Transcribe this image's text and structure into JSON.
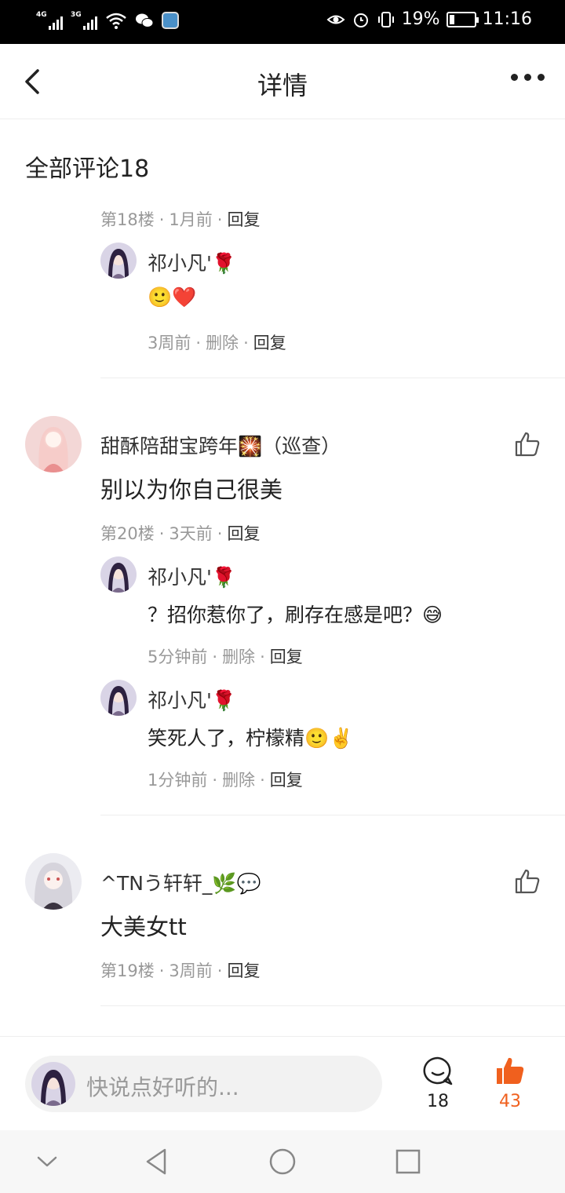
{
  "status_bar": {
    "signal_1": "4G",
    "signal_2": "3G",
    "battery": "19%",
    "time": "11:16"
  },
  "header": {
    "title": "详情"
  },
  "comments_title": "全部评论18",
  "first_block": {
    "meta": {
      "floor": "第18楼",
      "time": "1月前",
      "reply": "回复"
    },
    "replies": [
      {
        "name": "祁小凡'🌹",
        "text": "🙂❤️",
        "time": "3周前",
        "delete": "删除",
        "reply": "回复"
      }
    ]
  },
  "comments": [
    {
      "name": "甜酥陪甜宝跨年🎇（巡查）",
      "text": "别以为你自己很美",
      "meta": {
        "floor": "第20楼",
        "time": "3天前",
        "reply": "回复"
      },
      "replies": [
        {
          "name": "祁小凡'🌹",
          "text": "？招你惹你了，刷存在感是吧？😅",
          "time": "5分钟前",
          "delete": "删除",
          "reply": "回复"
        },
        {
          "name": "祁小凡'🌹",
          "text": "笑死人了，柠檬精🙂✌️",
          "time": "1分钟前",
          "delete": "删除",
          "reply": "回复"
        }
      ]
    },
    {
      "name": "^TNう轩轩_🌿💬",
      "text": "大美女tt",
      "meta": {
        "floor": "第19楼",
        "time": "3周前",
        "reply": "回复"
      }
    }
  ],
  "input_bar": {
    "placeholder": "快说点好听的...",
    "comment_count": "18",
    "like_count": "43"
  },
  "colors": {
    "accent": "#f0601e",
    "meta_gray": "#999999",
    "divider": "#eeeeee"
  },
  "icons": [
    "back-arrow-icon",
    "more-icon",
    "like-icon",
    "comment-icon",
    "thumb-filled-icon",
    "nav-back-icon",
    "nav-home-icon",
    "nav-recent-icon",
    "nav-down-icon"
  ]
}
